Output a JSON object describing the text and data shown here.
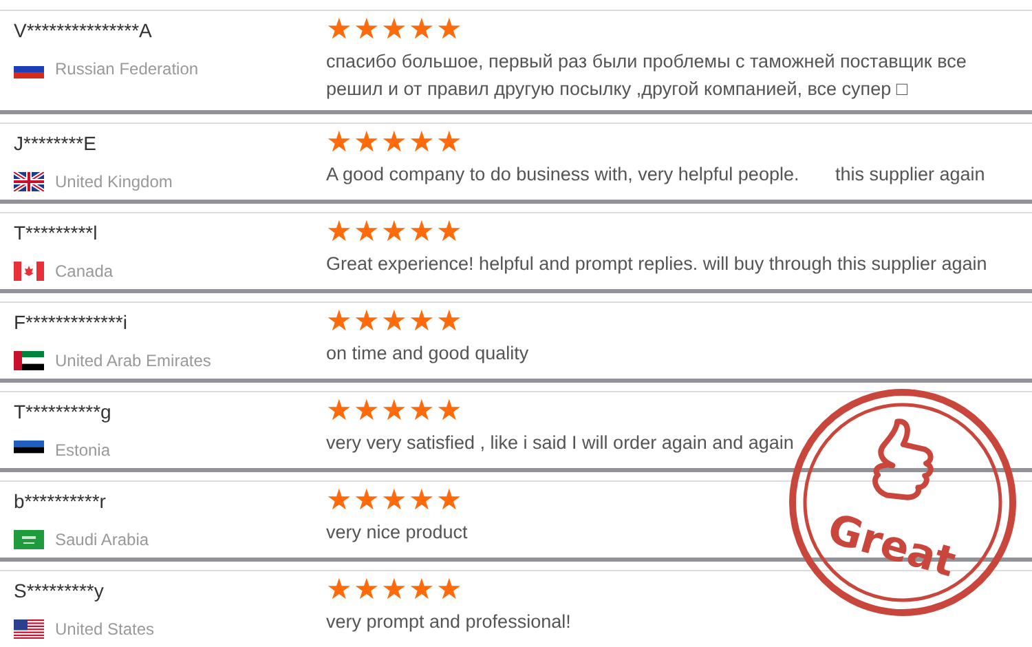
{
  "reviews": [
    {
      "name": "V***************A",
      "kind": "ru",
      "country": "Russian Federation",
      "stars": 5,
      "comment": "спасибо большое, первый раз были проблемы с таможней поставщик все решил и от правил другую посылку ,другой компанией, все супер □"
    },
    {
      "name": "J********E",
      "kind": "gb",
      "country": "United Kingdom",
      "stars": 5,
      "comment": "A good company to do business with, very helpful people.       this supplier again"
    },
    {
      "name": "T*********l",
      "kind": "ca",
      "country": "Canada",
      "stars": 5,
      "comment": "Great experience! helpful and prompt replies. will buy through this supplier again"
    },
    {
      "name": "F*************i",
      "kind": "ae",
      "country": "United Arab Emirates",
      "stars": 5,
      "comment": "on time and good quality"
    },
    {
      "name": "T**********g",
      "kind": "ee",
      "country": "Estonia",
      "stars": 5,
      "comment": "very very satisfied , like i said I will order again and again"
    },
    {
      "name": "b**********r",
      "kind": "sa",
      "country": "Saudi Arabia",
      "stars": 5,
      "comment": "very nice product"
    },
    {
      "name": "S*********y",
      "kind": "us",
      "country": "United States",
      "stars": 5,
      "comment": "very prompt and professional!"
    }
  ],
  "stamp": {
    "label": "Great"
  }
}
